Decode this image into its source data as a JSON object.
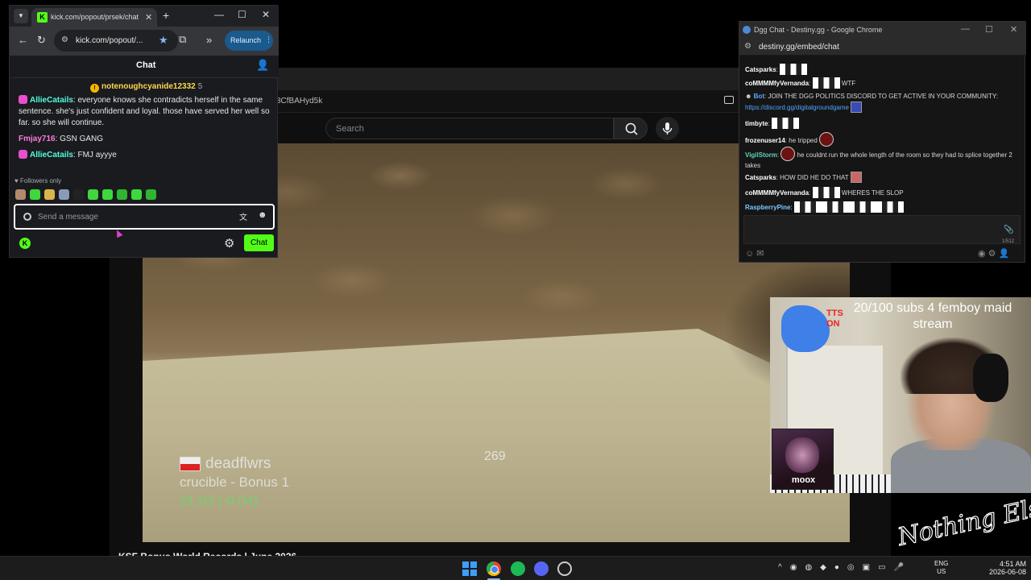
{
  "youtube": {
    "url_fragment": "8CfBAHyd5k",
    "search_placeholder": "Search",
    "video_title": "KSF Bonus World Records | June 2026"
  },
  "video_overlay": {
    "player": "deadflwrs",
    "map": "crucible - Bonus 1",
    "time": "21.03 (-0.04)",
    "speed": "269"
  },
  "kick": {
    "tab_title": "kick.com/popout/prsek/chat",
    "url": "kick.com/popout/...",
    "relaunch_label": "Relaunch",
    "header_title": "Chat",
    "pinned_user": "notenoughcyanide12332",
    "pinned_count": "5",
    "messages": [
      {
        "user": "AllieCatails",
        "user_color": "#53fcdc",
        "text": "everyone knows she contradicts herself in the same sentence. she's just confident and loyal. those have served her well so far. so she will continue."
      },
      {
        "user": "Fmjay716",
        "user_color": "#ff7ad9",
        "text": "GSN GANG"
      },
      {
        "user": "AllieCatails",
        "user_color": "#53fcdc",
        "text": "FMJ ayyye"
      }
    ],
    "followers_only": "Followers only",
    "input_placeholder": "Send a message",
    "send_label": "Chat"
  },
  "dgg": {
    "title": "Dgg Chat - Destiny.gg - Google Chrome",
    "url": "destiny.gg/embed/chat",
    "lines": [
      {
        "user": "Catsparks",
        "text": ""
      },
      {
        "user": "coMMMMfyVernanda",
        "text": "WTF"
      },
      {
        "user": "Bot",
        "text": "JOIN THE DGG POLITICS DISCORD TO GET ACTIVE IN YOUR COMMUNITY:",
        "link": "https://discord.gg/digitalgroundgame"
      },
      {
        "user": "timbyte",
        "text": ""
      },
      {
        "user": "frozenuser14",
        "text": "he tripped"
      },
      {
        "user": "VigilStorm",
        "text": "he couldnt run the whole length of the room so they had to splice together 2 takes"
      },
      {
        "user": "Catsparks",
        "text": "HOW DID HE DO THAT"
      },
      {
        "user": "coMMMMfyVernanda",
        "text": "WHERES THE SLOP"
      },
      {
        "user": "RaspberryPine",
        "text": ""
      }
    ],
    "char_count": "1/512"
  },
  "webcam": {
    "tts_label": "TTS ON",
    "subs_goal": "20/100 subs 4 femboy maid stream",
    "guest_name": "moox"
  },
  "logo_text": "Nothing Else?",
  "taskbar": {
    "lang_line1": "ENG",
    "lang_line2": "US",
    "time": "4:51 AM",
    "date": "2026-06-08"
  },
  "colors": {
    "kick_green": "#53fc18",
    "dgg_link": "#4ea6ff"
  }
}
